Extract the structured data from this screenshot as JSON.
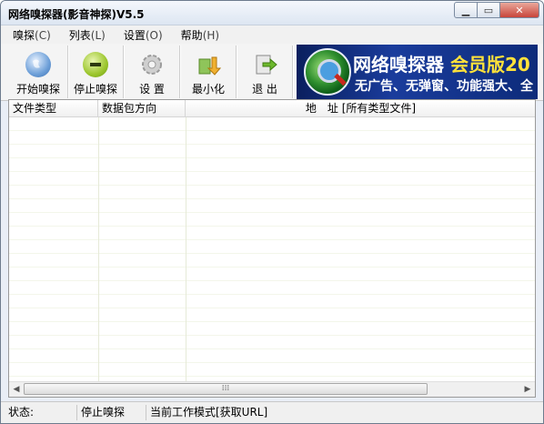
{
  "window": {
    "title": "网络嗅探器(影音神探)V5.5",
    "controls": [
      "minimize-icon",
      "maximize-icon",
      "close-icon"
    ]
  },
  "menu": [
    {
      "label": "嗅探",
      "accel": "(C)"
    },
    {
      "label": "列表",
      "accel": "(L)"
    },
    {
      "label": "设置",
      "accel": "(O)"
    },
    {
      "label": "帮助",
      "accel": "(H)"
    }
  ],
  "toolbar": {
    "buttons": [
      {
        "label": "开始嗅探",
        "icon": "globe-icon"
      },
      {
        "label": "停止嗅探",
        "icon": "stop-icon"
      },
      {
        "label": "设 置",
        "icon": "gear-icon"
      },
      {
        "label": "最小化",
        "icon": "minimize-arrow-icon"
      },
      {
        "label": "退 出",
        "icon": "exit-icon"
      }
    ]
  },
  "banner": {
    "line1_a": "网络嗅探器",
    "line1_b": "会员版20",
    "line2": "无广告、无弹窗、功能强大、全"
  },
  "list": {
    "columns": [
      "文件类型",
      "数据包方向",
      "地　址 [所有类型文件]"
    ],
    "rows": []
  },
  "status": {
    "label": "状态:",
    "state": "停止嗅探",
    "mode": "当前工作模式[获取URL]"
  },
  "colors": {
    "banner_bg": "#1a3c9c",
    "banner_highlight": "#ffe23a"
  }
}
